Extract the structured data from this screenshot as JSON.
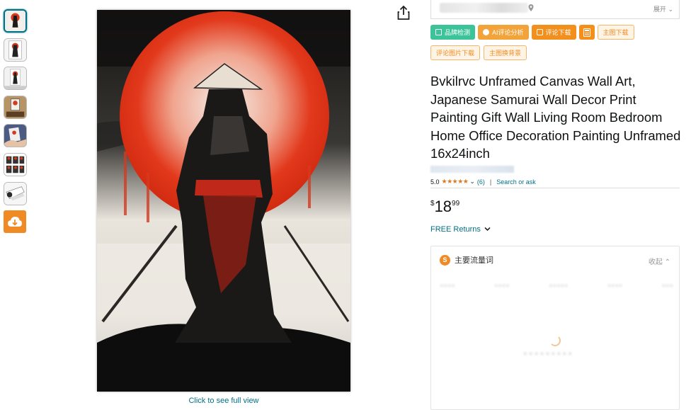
{
  "thumbnails": [
    {
      "name": "thumb-samurai-red-sun",
      "active": true
    },
    {
      "name": "thumb-samurai-framed"
    },
    {
      "name": "thumb-samurai-wall"
    },
    {
      "name": "thumb-samurai-room"
    },
    {
      "name": "thumb-samurai-hand"
    },
    {
      "name": "thumb-samurai-sizes"
    },
    {
      "name": "thumb-samurai-roll"
    }
  ],
  "toolbar": {
    "row1": [
      "品牌检测",
      "AI评论分析",
      "评论下载",
      "主图下载"
    ],
    "row2": [
      "评论图片下载",
      "主图换背景"
    ]
  },
  "top_bar": {
    "expand_label": "展开"
  },
  "product": {
    "title": "Bvkilrvc Unframed Canvas Wall Art, Japanese Samurai Wall Decor Print Painting Gift Wall Living Room Bedroom Home Office Decoration Painting Unframed 16x24inch",
    "rating_value": "5.0",
    "rating_stars": "★★★★★",
    "rating_count": "(6)",
    "search_ask": "Search or ask",
    "price_symbol": "$",
    "price_whole": "18",
    "price_fraction": "99",
    "returns": "FREE Returns",
    "full_view": "Click to see full view"
  },
  "panel": {
    "title": "主要流量词",
    "collapse_label": "收起"
  },
  "colors": {
    "link": "#007185",
    "star": "#de7921",
    "green": "#3cc39a",
    "orange": "#f28f1d"
  }
}
